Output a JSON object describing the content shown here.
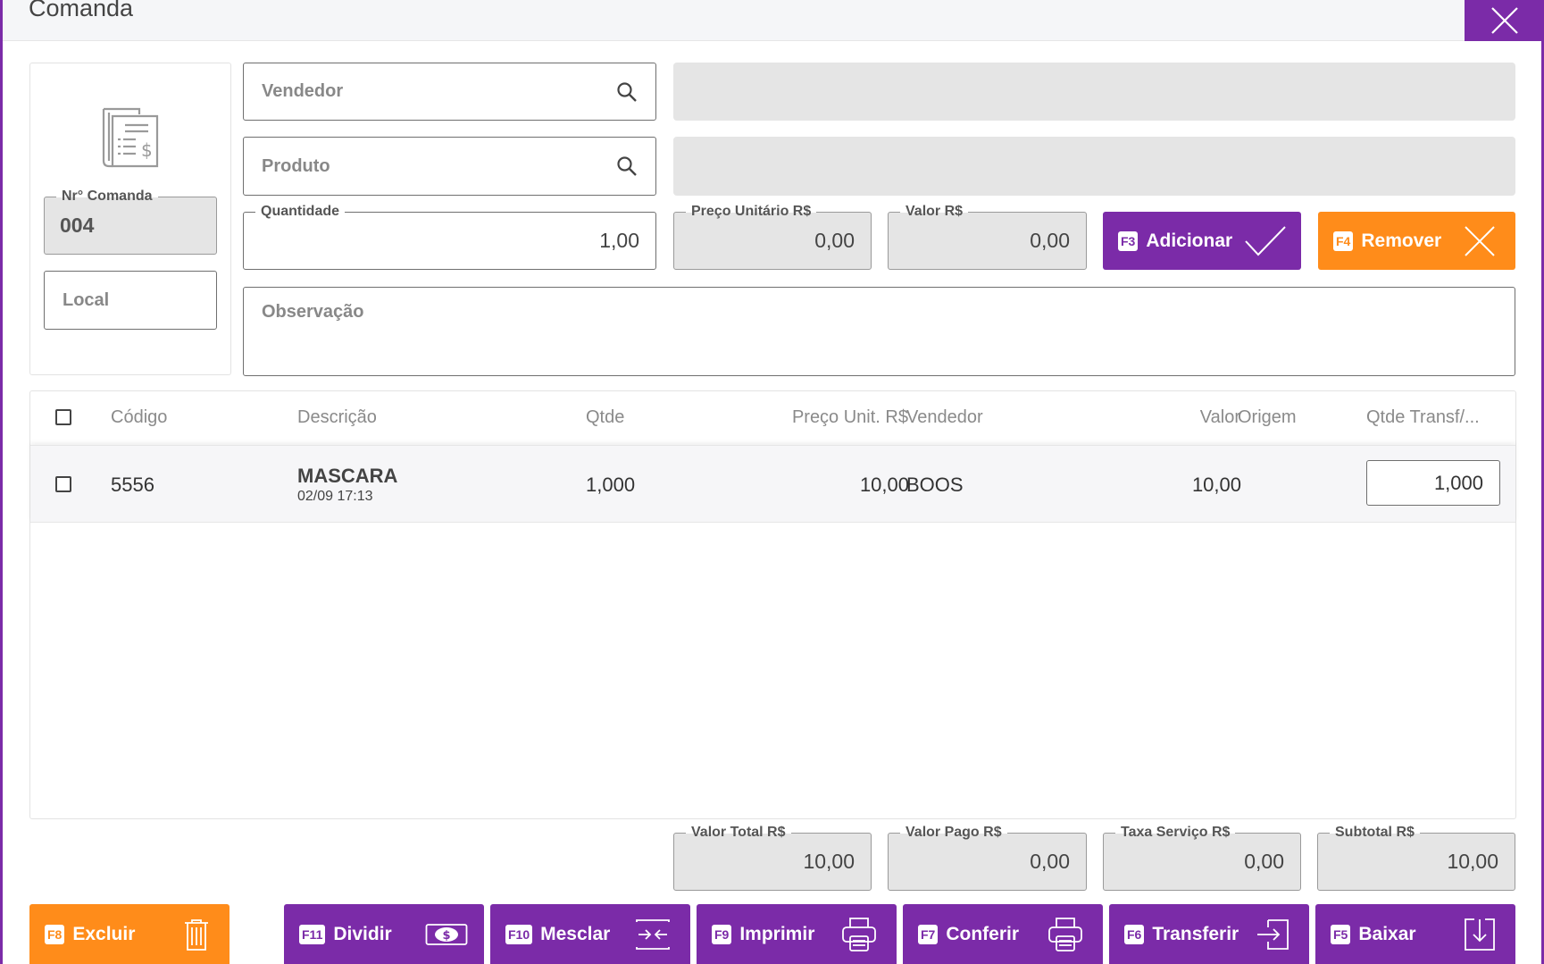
{
  "modal": {
    "title": "Comanda"
  },
  "comanda": {
    "number_label": "Nr° Comanda",
    "number_value": "004",
    "local_placeholder": "Local"
  },
  "form": {
    "vendedor_placeholder": "Vendedor",
    "produto_placeholder": "Produto",
    "quantidade_label": "Quantidade",
    "quantidade_value": "1,00",
    "preco_unitario_label": "Preço Unitário R$",
    "preco_unitario_value": "0,00",
    "valor_label": "Valor R$",
    "valor_value": "0,00",
    "observacao_placeholder": "Observação"
  },
  "actions": {
    "adicionar": {
      "key": "F3",
      "label": "Adicionar"
    },
    "remover": {
      "key": "F4",
      "label": "Remover"
    }
  },
  "table": {
    "columns": [
      "Código",
      "Descrição",
      "Qtde",
      "Preço Unit. R$",
      "Vendedor",
      "Valor",
      "Origem",
      "Qtde Transf/..."
    ],
    "rows": [
      {
        "codigo": "5556",
        "descricao": "MASCARA",
        "data": "02/09 17:13",
        "qtde": "1,000",
        "preco_unit": "10,00",
        "vendedor": "BOOS",
        "valor": "10,00",
        "origem": "",
        "qtde_transf": "1,000"
      }
    ]
  },
  "totals": {
    "valor_total_label": "Valor Total R$",
    "valor_total_value": "10,00",
    "valor_pago_label": "Valor Pago R$",
    "valor_pago_value": "0,00",
    "taxa_servico_label": "Taxa Serviço R$",
    "taxa_servico_value": "0,00",
    "subtotal_label": "Subtotal R$",
    "subtotal_value": "10,00"
  },
  "footer": {
    "excluir": {
      "key": "F8",
      "label": "Excluir"
    },
    "dividir": {
      "key": "F11",
      "label": "Dividir"
    },
    "mesclar": {
      "key": "F10",
      "label": "Mesclar"
    },
    "imprimir": {
      "key": "F9",
      "label": "Imprimir"
    },
    "conferir": {
      "key": "F7",
      "label": "Conferir"
    },
    "transferir": {
      "key": "F6",
      "label": "Transferir"
    },
    "baixar": {
      "key": "F5",
      "label": "Baixar"
    }
  },
  "icons": {
    "close": "close-icon",
    "document": "invoice-document-icon",
    "search": "search-icon",
    "check": "check-icon",
    "x": "x-icon",
    "trash": "trash-icon",
    "money": "money-icon",
    "merge": "merge-icon",
    "print": "printer-icon",
    "transfer": "transfer-icon",
    "download": "download-icon"
  },
  "colors": {
    "primary": "#7b2ba8",
    "accent": "#ff8c1a",
    "readonly_bg": "#e5e5e5"
  }
}
